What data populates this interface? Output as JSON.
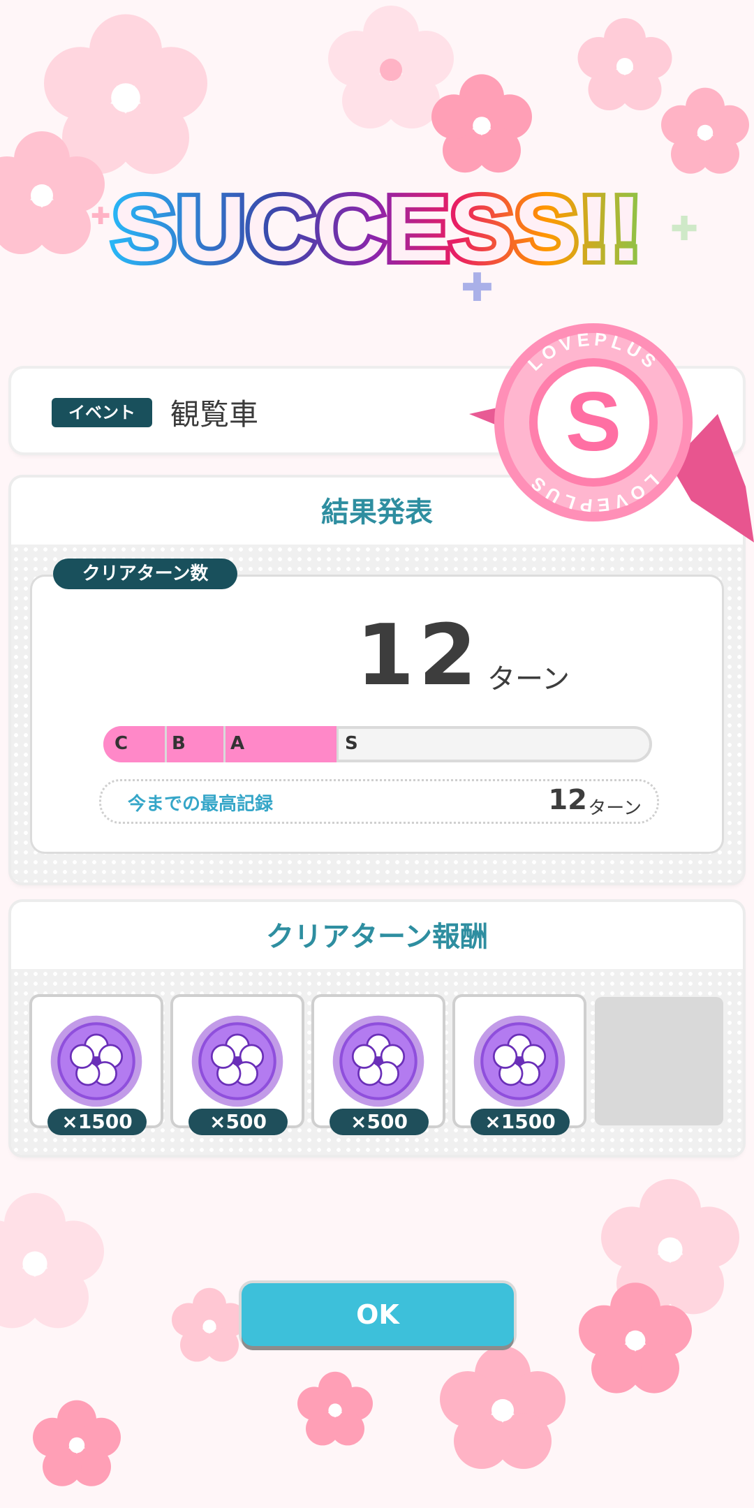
{
  "title": {
    "text": "SUCCESS!!"
  },
  "event": {
    "tag": "イベント",
    "name": "観覧車"
  },
  "rank_badge": {
    "letter": "S",
    "ring_text": "LOVEPLUS"
  },
  "result": {
    "header": "結果発表",
    "clear_turns_label": "クリアターン数",
    "turn_value": "12",
    "turn_unit": "ターン",
    "rank_bar": {
      "segments": [
        "C",
        "B",
        "A",
        "S"
      ],
      "current_rank": "S"
    },
    "best_record_label": "今までの最高記録",
    "best_record_value": "12",
    "best_record_unit": "ターン"
  },
  "rewards": {
    "header": "クリアターン報酬",
    "items": [
      {
        "icon": "sakura-medal-icon",
        "qty": "×1500"
      },
      {
        "icon": "sakura-medal-icon",
        "qty": "×500"
      },
      {
        "icon": "sakura-medal-icon",
        "qty": "×500"
      },
      {
        "icon": "sakura-medal-icon",
        "qty": "×1500"
      }
    ]
  },
  "ok_button": {
    "label": "OK"
  },
  "colors": {
    "accent_dark": "#19505c",
    "accent_teal": "#2e8ea0",
    "rank_fill": "#ff88c8",
    "ok_button": "#3dc0da"
  }
}
